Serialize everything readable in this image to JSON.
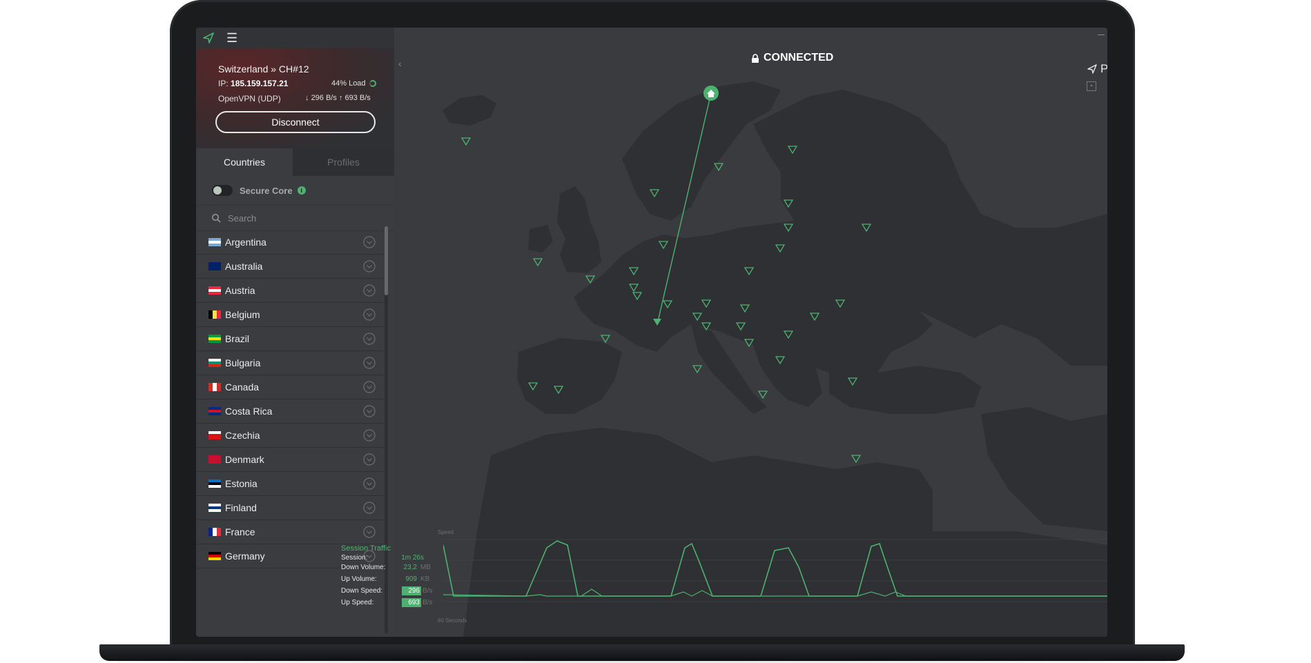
{
  "titlebar": {
    "logo_icon": "protonvpn-logo-icon",
    "menu_icon": "hamburger-menu-icon",
    "menu_glyph": "☰"
  },
  "status": {
    "server": "Switzerland » CH#12",
    "ip_label": "IP:",
    "ip": "185.159.157.21",
    "load": "44% Load",
    "protocol": "OpenVPN (UDP)",
    "down_speed": "296 B/s",
    "up_speed": "693 B/s",
    "disconnect_label": "Disconnect"
  },
  "tabs": {
    "countries": "Countries",
    "profiles": "Profiles"
  },
  "secure_core": {
    "label": "Secure Core",
    "enabled": false,
    "info_glyph": "i"
  },
  "search": {
    "placeholder": "Search"
  },
  "countries": [
    {
      "name": "Argentina",
      "flag": "argentina-flag-icon"
    },
    {
      "name": "Australia",
      "flag": "australia-flag-icon"
    },
    {
      "name": "Austria",
      "flag": "austria-flag-icon"
    },
    {
      "name": "Belgium",
      "flag": "belgium-flag-icon"
    },
    {
      "name": "Brazil",
      "flag": "brazil-flag-icon"
    },
    {
      "name": "Bulgaria",
      "flag": "bulgaria-flag-icon"
    },
    {
      "name": "Canada",
      "flag": "canada-flag-icon"
    },
    {
      "name": "Costa Rica",
      "flag": "costa-rica-flag-icon"
    },
    {
      "name": "Czechia",
      "flag": "czechia-flag-icon"
    },
    {
      "name": "Denmark",
      "flag": "denmark-flag-icon"
    },
    {
      "name": "Estonia",
      "flag": "estonia-flag-icon"
    },
    {
      "name": "Finland",
      "flag": "finland-flag-icon"
    },
    {
      "name": "France",
      "flag": "france-flag-icon"
    },
    {
      "name": "Germany",
      "flag": "germany-flag-icon"
    }
  ],
  "map": {
    "status": "CONNECTED",
    "corner_text": "Pro",
    "zoom_out": "-",
    "collapse_glyph": "‹"
  },
  "traffic": {
    "title": "Session Traffic",
    "session_label": "Session:",
    "session_value": "1m 26s",
    "down_volume_label": "Down Volume:",
    "down_volume_value": "23,2",
    "down_volume_unit": "MB",
    "up_volume_label": "Up Volume:",
    "up_volume_value": "909",
    "up_volume_unit": "KB",
    "down_speed_label": "Down Speed:",
    "down_speed_value": "296",
    "down_speed_unit": "B/s",
    "up_speed_label": "Up Speed:",
    "up_speed_value": "693",
    "up_speed_unit": "B/s",
    "chart_ylabel": "Speed",
    "chart_xlabel": "60 Seconds"
  },
  "colors": {
    "accent": "#4db26f",
    "land": "#2e2f33",
    "sea": "#3a3b3f",
    "sidebar": "#3b3c40"
  }
}
